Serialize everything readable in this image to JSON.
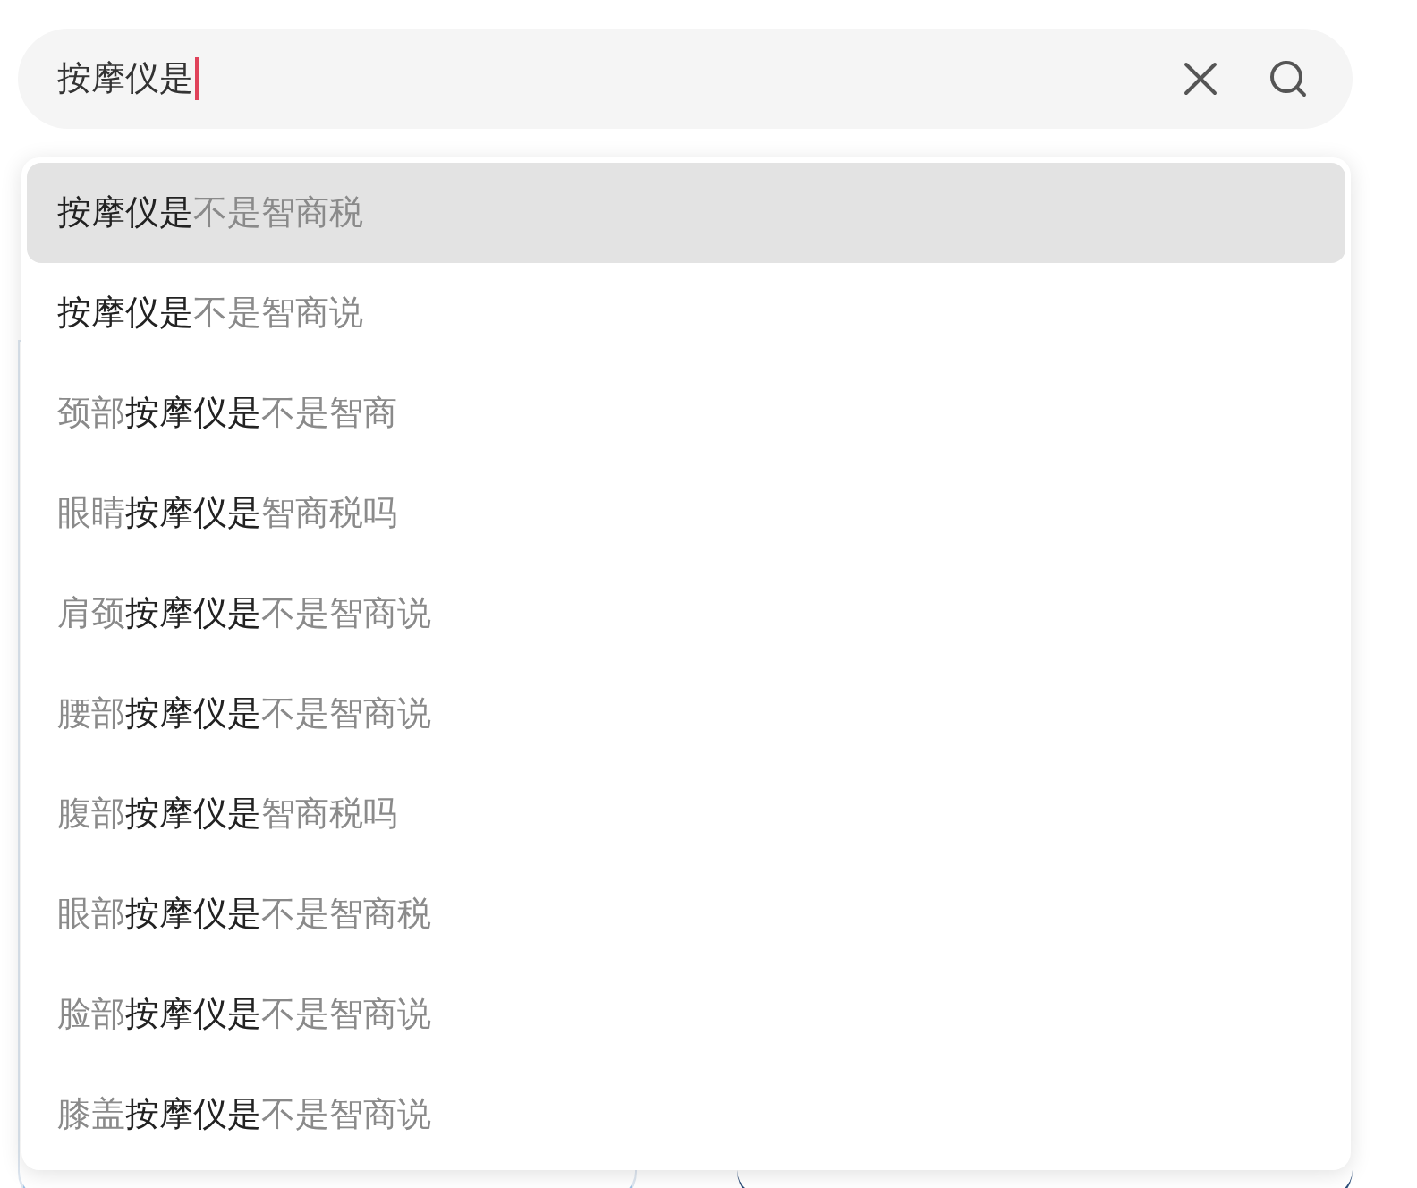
{
  "search": {
    "value": "按摩仪是"
  },
  "suggestions": [
    {
      "match": "按摩仪是",
      "after": "不是智商税",
      "selected": true
    },
    {
      "match": "按摩仪是",
      "after": "不是智商说",
      "selected": false
    },
    {
      "before": "颈部",
      "match": "按摩仪是",
      "after": "不是智商",
      "selected": false
    },
    {
      "before": "眼睛",
      "match": "按摩仪是",
      "after": "智商税吗",
      "selected": false
    },
    {
      "before": "肩颈",
      "match": "按摩仪是",
      "after": "不是智商说",
      "selected": false
    },
    {
      "before": "腰部",
      "match": "按摩仪是",
      "after": "不是智商说",
      "selected": false
    },
    {
      "before": "腹部",
      "match": "按摩仪是",
      "after": "智商税吗",
      "selected": false
    },
    {
      "before": "眼部",
      "match": "按摩仪是",
      "after": "不是智商税",
      "selected": false
    },
    {
      "before": "脸部",
      "match": "按摩仪是",
      "after": "不是智商说",
      "selected": false
    },
    {
      "before": "膝盖",
      "match": "按摩仪是",
      "after": "不是智商说",
      "selected": false
    }
  ]
}
